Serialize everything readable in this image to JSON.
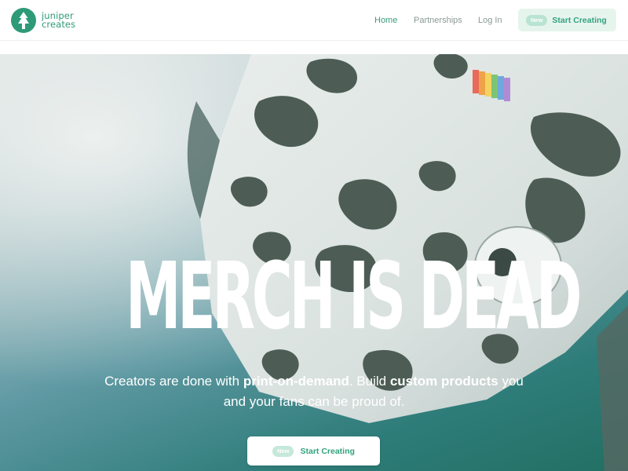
{
  "header": {
    "logo_line1": "juniper",
    "logo_line2": "creates",
    "nav": {
      "home": "Home",
      "partnerships": "Partnerships",
      "login": "Log In"
    },
    "cta": {
      "badge": "New",
      "label": "Start Creating"
    }
  },
  "hero": {
    "headline": "MERCH IS DEAD",
    "subcopy": {
      "part1": "Creators are done with ",
      "bold1": "print-on-demand",
      "part2": ". Build ",
      "bold2": "custom products",
      "part3": " you and your fans can be proud of."
    },
    "cta": {
      "badge": "New",
      "label": "Start Creating"
    }
  },
  "colors": {
    "brand": "#2e9a78",
    "cta_background": "#e6f4ee"
  }
}
